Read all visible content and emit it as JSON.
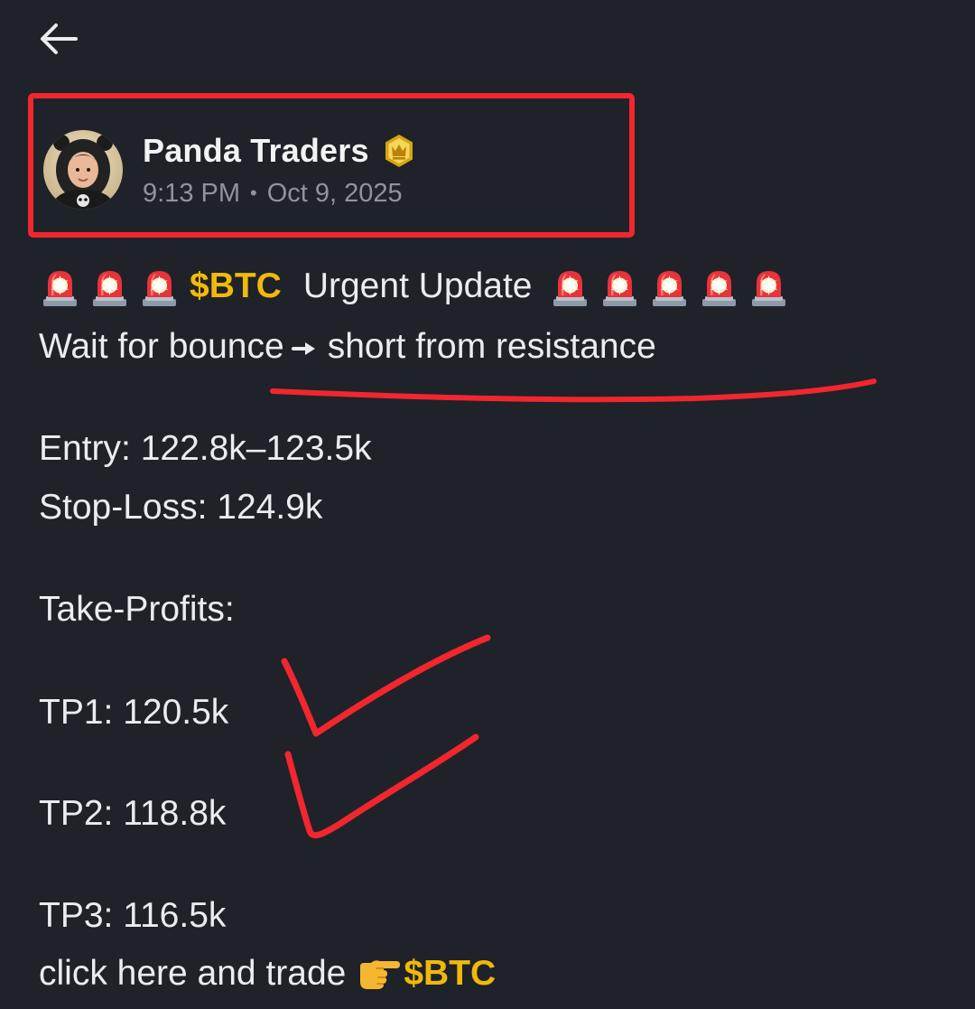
{
  "header": {
    "back_icon": "arrow-left-icon"
  },
  "post": {
    "author_name": "Panda Traders",
    "author_badge_icon": "crown-badge-icon",
    "time": "9:13 PM",
    "separator": "•",
    "date": "Oct 9, 2025",
    "headline_ticker": "$BTC",
    "headline_text": "Urgent Update",
    "siren_icon": "police-siren-emoji",
    "line2_before": "Wait for bounce",
    "line2_arrow_icon": "right-arrow-icon",
    "line2_after": "short from resistance",
    "entry": "Entry: 122.8k–123.5k",
    "stop_loss": "Stop-Loss: 124.9k",
    "take_profits_label": "Take-Profits:",
    "tp1": "TP1: 120.5k",
    "tp2": "TP2: 118.8k",
    "tp3": "TP3: 116.5k",
    "cta_text": "click here and trade",
    "cta_hand_icon": "pointing-right-hand-emoji",
    "cta_ticker": "$BTC"
  },
  "annotations": {
    "color": "#f2262e"
  },
  "colors": {
    "background": "#1f2229",
    "text": "#eaecef",
    "muted": "#8f949c",
    "ticker": "#f0b90b"
  }
}
